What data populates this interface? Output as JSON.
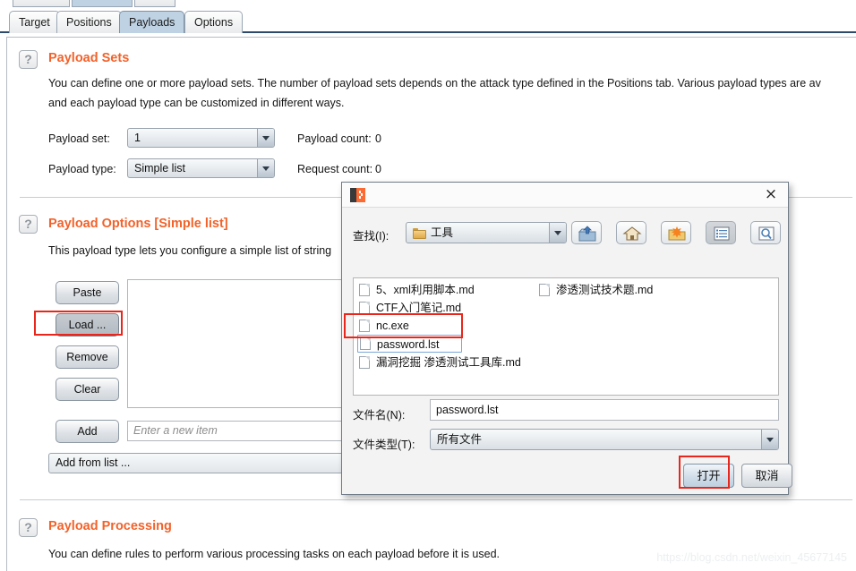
{
  "window": {
    "ghost_tabs": [
      "",
      "",
      ""
    ]
  },
  "tabs": [
    {
      "label": "Target",
      "active": false
    },
    {
      "label": "Positions",
      "active": false
    },
    {
      "label": "Payloads",
      "active": true
    },
    {
      "label": "Options",
      "active": false
    }
  ],
  "payload_sets": {
    "help_icon": "?",
    "title": "Payload Sets",
    "description_line1": "You can define one or more payload sets. The number of payload sets depends on the attack type defined in the Positions tab. Various payload types are av",
    "description_line2": "and each payload type can be customized in different ways.",
    "payload_set_label": "Payload set:",
    "payload_set_value": "1",
    "payload_type_label": "Payload type:",
    "payload_type_value": "Simple list",
    "payload_count_label": "Payload count:",
    "payload_count_value": "0",
    "request_count_label": "Request count:",
    "request_count_value": "0"
  },
  "payload_options": {
    "help_icon": "?",
    "title": "Payload Options [Simple list]",
    "description": "This payload type lets you configure a simple list of string",
    "buttons": [
      {
        "label": "Paste",
        "pressed": false
      },
      {
        "label": "Load ...",
        "pressed": true
      },
      {
        "label": "Remove",
        "pressed": false
      },
      {
        "label": "Clear",
        "pressed": false
      }
    ],
    "add_button": "Add",
    "new_item_placeholder": "Enter a new item",
    "add_from_list": "Add from list ..."
  },
  "payload_processing": {
    "help_icon": "?",
    "title": "Payload Processing",
    "description": "You can define rules to perform various processing tasks on each payload before it is used."
  },
  "file_dialog": {
    "app_icon": "burp-logo",
    "close_icon": "×",
    "look_in_label": "查找(I):",
    "look_in_value": "工具",
    "toolbar": [
      {
        "name": "up-folder-icon"
      },
      {
        "name": "home-icon"
      },
      {
        "name": "new-folder-icon"
      },
      {
        "name": "list-view-icon"
      },
      {
        "name": "details-view-icon"
      }
    ],
    "files": [
      {
        "name": "5、xml利用脚本.md",
        "col": 0,
        "row": 0,
        "selected": false
      },
      {
        "name": "CTF入门笔记.md",
        "col": 0,
        "row": 1,
        "selected": false
      },
      {
        "name": "nc.exe",
        "col": 0,
        "row": 2,
        "selected": false
      },
      {
        "name": "password.lst",
        "col": 0,
        "row": 3,
        "selected": true
      },
      {
        "name": "漏洞挖掘 渗透测试工具库.md",
        "col": 0,
        "row": 4,
        "selected": false
      },
      {
        "name": "渗透测试技术题.md",
        "col": 1,
        "row": 0,
        "selected": false
      }
    ],
    "file_name_label": "文件名(N):",
    "file_name_value": "password.lst",
    "file_type_label": "文件类型(T):",
    "file_type_value": "所有文件",
    "open_button": "打开",
    "cancel_button": "取消"
  },
  "annotations": {
    "accent_red": "#e8261b",
    "accent_orange": "#f2622a"
  },
  "watermark": "https://blog.csdn.net/weixin_45677145"
}
